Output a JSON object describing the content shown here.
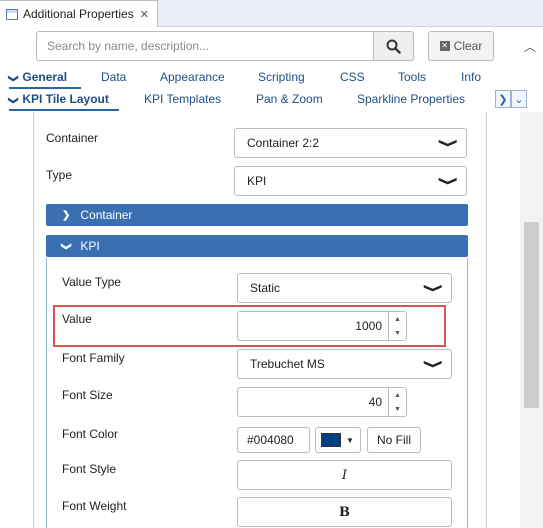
{
  "window": {
    "title": "Additional Properties",
    "close_glyph": "✕"
  },
  "search": {
    "placeholder": "Search by name, description...",
    "clear_label": "Clear"
  },
  "tabs_row1": [
    {
      "label": "General",
      "active": true
    },
    {
      "label": "Data"
    },
    {
      "label": "Appearance"
    },
    {
      "label": "Scripting"
    },
    {
      "label": "CSS"
    },
    {
      "label": "Tools"
    },
    {
      "label": "Info"
    }
  ],
  "tabs_row2": [
    {
      "label": "KPI Tile Layout",
      "active": true
    },
    {
      "label": "KPI Templates"
    },
    {
      "label": "Pan & Zoom"
    },
    {
      "label": "Sparkline Properties"
    }
  ],
  "props": {
    "container_label": "Container",
    "container_value": "Container 2:2",
    "type_label": "Type",
    "type_value": "KPI"
  },
  "sections": {
    "container": "Container",
    "kpi": "KPI"
  },
  "kpi": {
    "value_type_label": "Value Type",
    "value_type_value": "Static",
    "value_label": "Value",
    "value_value": "1000",
    "font_family_label": "Font Family",
    "font_family_value": "Trebuchet MS",
    "font_size_label": "Font Size",
    "font_size_value": "40",
    "font_color_label": "Font Color",
    "font_color_value": "#004080",
    "no_fill_label": "No Fill",
    "font_style_label": "Font Style",
    "font_style_value": "I",
    "font_weight_label": "Font Weight",
    "font_weight_value": "B"
  },
  "colors": {
    "font_color_swatch": "#004080",
    "section_header": "#3a6fb1",
    "highlight": "#d9534f"
  }
}
